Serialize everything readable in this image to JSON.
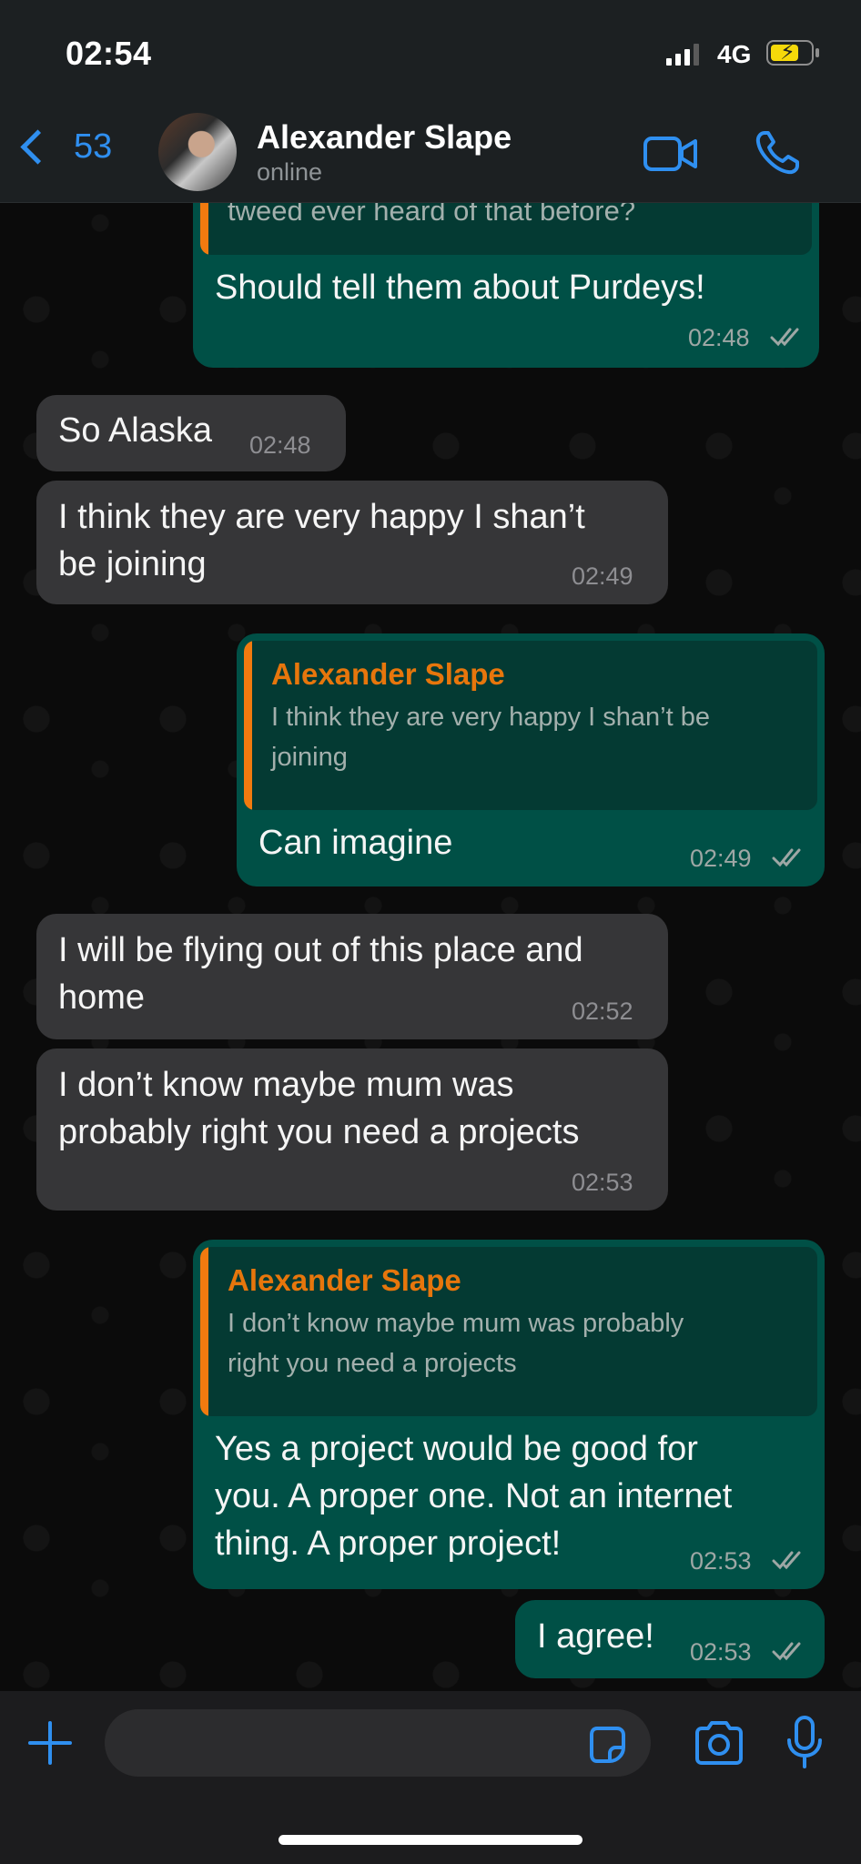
{
  "status_bar": {
    "time": "02:54",
    "network": "4G"
  },
  "header": {
    "back_count": "53",
    "contact_name": "Alexander Slape",
    "contact_status": "online",
    "icons": [
      "chevron-left-icon",
      "video-call-icon",
      "phone-icon"
    ]
  },
  "messages": [
    {
      "dir": "out",
      "quote_text": "tweed ever heard of that before?",
      "text": "Should tell them about Purdeys!",
      "time": "02:48"
    },
    {
      "dir": "in",
      "text": "So Alaska",
      "time": "02:48"
    },
    {
      "dir": "in",
      "text_lines": [
        "I think they are very happy I shan’t",
        "be joining"
      ],
      "time": "02:49"
    },
    {
      "dir": "out",
      "quote_author": "Alexander Slape",
      "quote_lines": [
        "I think they are very happy I shan’t be",
        "joining"
      ],
      "text": "Can imagine",
      "time": "02:49"
    },
    {
      "dir": "in",
      "text_lines": [
        "I will be flying out of this place and",
        "home"
      ],
      "time": "02:52"
    },
    {
      "dir": "in",
      "text_lines": [
        "I don’t know maybe mum was",
        "probably right you need a projects"
      ],
      "time": "02:53"
    },
    {
      "dir": "out",
      "quote_author": "Alexander Slape",
      "quote_lines": [
        "I don’t know maybe mum was probably",
        "right you need a projects"
      ],
      "text_lines": [
        "Yes a project would be good for",
        "you. A proper one. Not an internet",
        "thing. A proper project!"
      ],
      "time": "02:53"
    },
    {
      "dir": "out",
      "text": "I agree!",
      "time": "02:53"
    }
  ],
  "input_bar": {
    "icons": [
      "plus-icon",
      "sticker-icon",
      "camera-icon",
      "microphone-icon"
    ]
  },
  "colors": {
    "accent": "#2f8ff0",
    "outgoing_bubble": "#005046",
    "incoming_bubble": "#363638",
    "quote_author": "#e7760c"
  }
}
